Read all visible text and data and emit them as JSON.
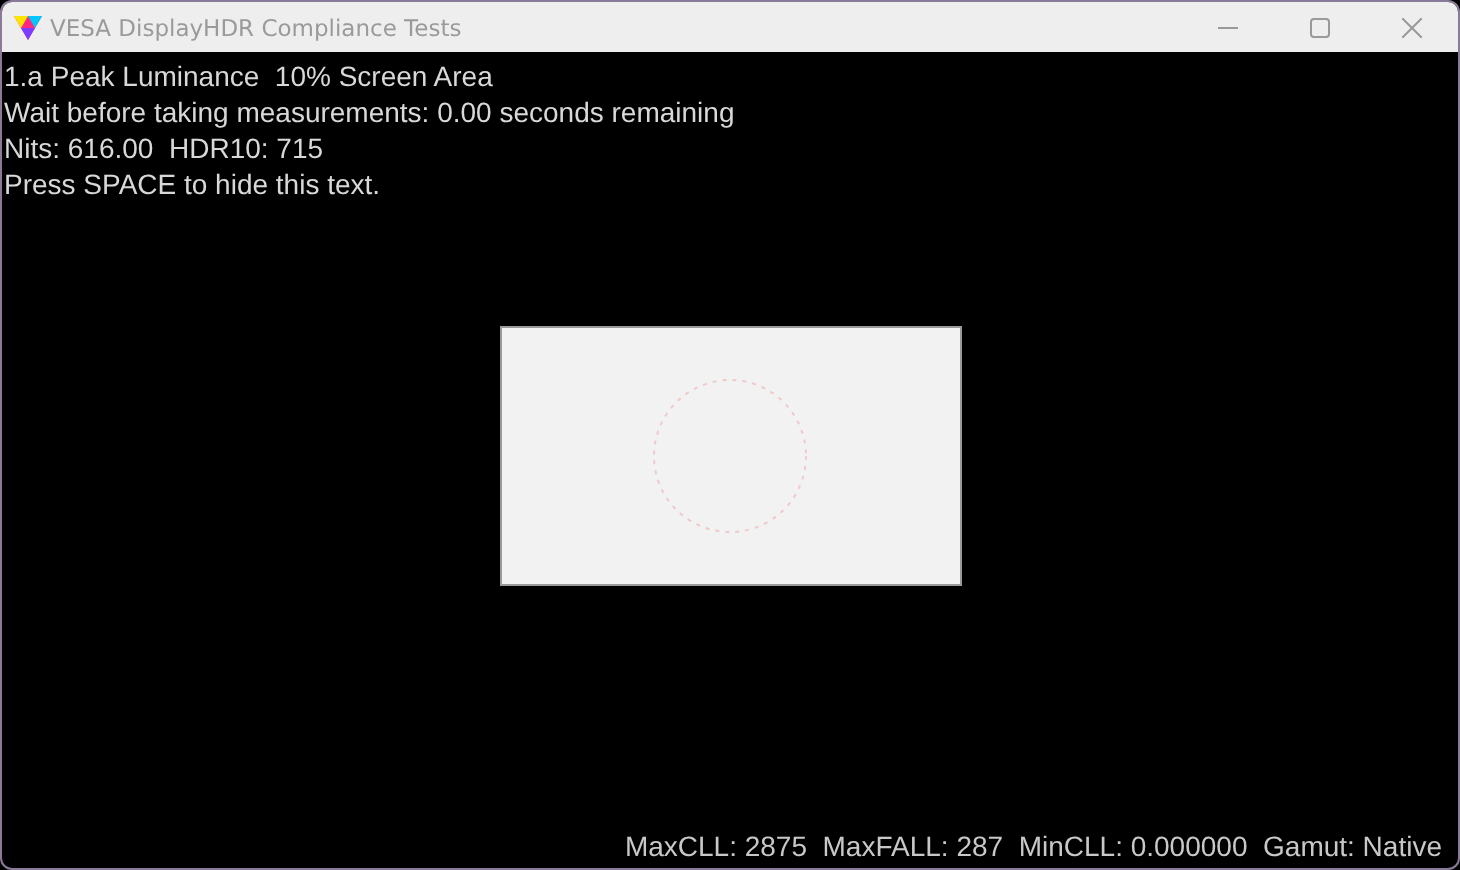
{
  "window": {
    "title": "VESA DisplayHDR Compliance Tests"
  },
  "overlay_lines": [
    "1.a Peak Luminance  10% Screen Area",
    "Wait before taking measurements: 0.00 seconds remaining",
    "Nits: 616.00  HDR10: 715",
    "Press SPACE to hide this text."
  ],
  "status_line": "MaxCLL: 2875  MaxFALL: 287  MinCLL: 0.000000  Gamut: Native"
}
